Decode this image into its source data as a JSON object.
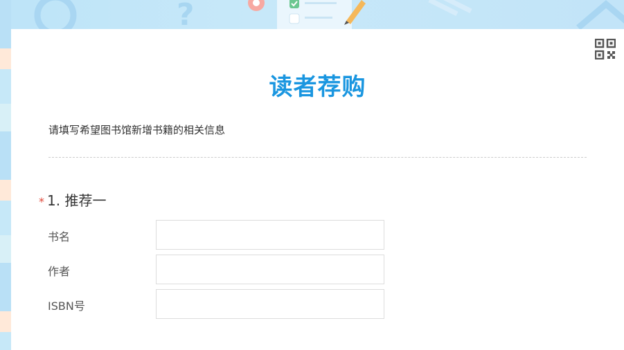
{
  "form": {
    "title": "读者荐购",
    "description": "请填写希望图书馆新增书籍的相关信息",
    "qr_icon": "qr-code-icon"
  },
  "question": {
    "required_mark": "*",
    "title": "1. 推荐一",
    "fields": [
      {
        "label": "书名",
        "value": ""
      },
      {
        "label": "作者",
        "value": ""
      },
      {
        "label": "ISBN号",
        "value": ""
      }
    ]
  },
  "colors": {
    "accent": "#1a96e0",
    "required": "#e0483a",
    "banner": "#bfe3f7"
  }
}
